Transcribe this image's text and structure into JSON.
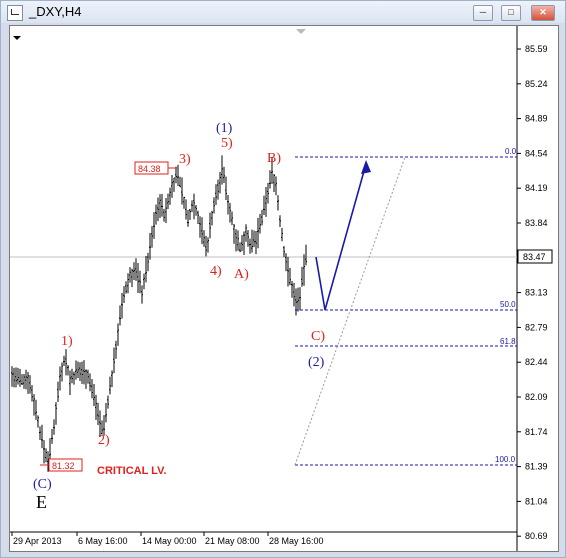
{
  "window": {
    "title": "_DXY,H4"
  },
  "chart_data": {
    "type": "ohlc",
    "symbol": "_DXY",
    "timeframe": "H4",
    "price_axis": [
      "85.59",
      "85.24",
      "84.89",
      "84.54",
      "84.19",
      "83.84",
      "83.47",
      "83.13",
      "82.79",
      "82.44",
      "82.09",
      "81.74",
      "81.39",
      "81.04",
      "80.69"
    ],
    "current_price": "83.47",
    "time_axis": [
      "29 Apr 2013",
      "6 May 16:00",
      "14 May 00:00",
      "21 May 08:00",
      "28 May 16:00"
    ],
    "price_labels": [
      {
        "id": "high",
        "text": "84.38"
      },
      {
        "id": "low",
        "text": "81.32"
      }
    ],
    "waves_red": [
      "1)",
      "2)",
      "3)",
      "4)",
      "5)",
      "A)",
      "B)",
      "C)"
    ],
    "waves_blue": [
      "(1)",
      "(2)",
      "(C)"
    ],
    "wave_black": "E",
    "critical_level": "CRITICAL LV.",
    "fib_levels": [
      "0.0",
      "50.0",
      "61.8",
      "100.0"
    ]
  }
}
